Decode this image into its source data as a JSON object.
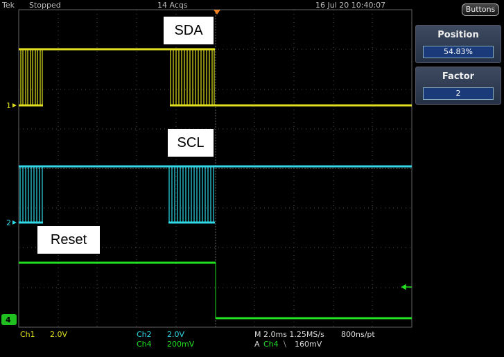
{
  "status": {
    "brand": "Tek",
    "state": "Stopped",
    "acquisitions": "14 Acqs",
    "datetime": "16 Jul 20 10:40:07"
  },
  "buttons_label": "Buttons",
  "menu": {
    "position": {
      "title": "Position",
      "value": "54.83%"
    },
    "factor": {
      "title": "Factor",
      "value": "2"
    }
  },
  "signal_labels": {
    "sda": "SDA",
    "scl": "SCL",
    "reset": "Reset"
  },
  "channel_markers": {
    "ch1": "1",
    "ch2": "2",
    "ch4": "4"
  },
  "readout": {
    "ch1_name": "Ch1",
    "ch1_scale": "2.0V",
    "ch2_name": "Ch2",
    "ch2_scale": "2.0V",
    "ch4_name": "Ch4",
    "ch4_scale": "200mV",
    "timebase": "M 2.0ms 1.25MS/s",
    "resolution": "800ns/pt",
    "trigger_prefix": "A",
    "trigger_channel": "Ch4",
    "trigger_slope": "⧹",
    "trigger_level": "160mV"
  },
  "colors": {
    "ch1": "#e0e020",
    "ch2": "#30d8e8",
    "ch4": "#20e020",
    "grid": "#555555"
  }
}
